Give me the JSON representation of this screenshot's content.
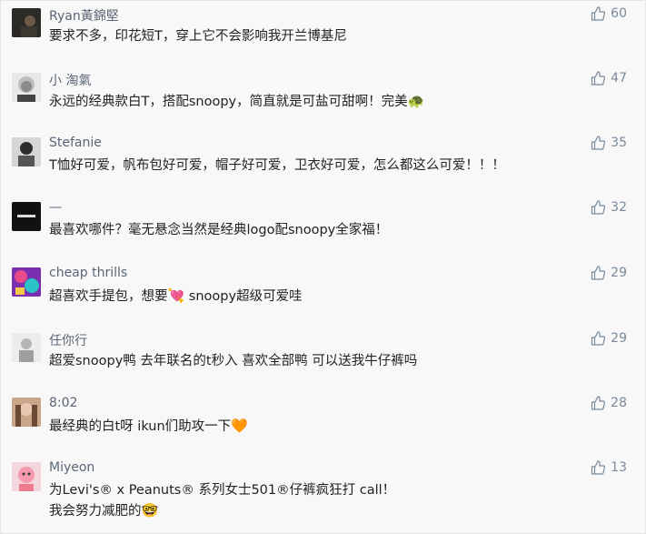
{
  "comments": [
    {
      "username": "Ryan黃錦堅",
      "text": "要求不多，印花短T，穿上它不会影响我开兰博基尼",
      "likes": "60",
      "avatar": "dark-photo"
    },
    {
      "username": "小 淘氣",
      "text": "永远的经典款白T，搭配snoopy，简直就是可盐可甜啊！完美",
      "emoji": "🐢",
      "likes": "47",
      "avatar": "einstein-photo"
    },
    {
      "username": "Stefanie",
      "text": "T恤好可爱，帆布包好可爱，帽子好可爱，卫衣好可爱，怎么都这么可爱！！！",
      "likes": "35",
      "avatar": "person-photo"
    },
    {
      "username": "—",
      "text": "最喜欢哪件？毫无悬念当然是经典logo配snoopy全家福！",
      "likes": "32",
      "avatar": "black-logo"
    },
    {
      "username": "cheap thrills",
      "text": "超喜欢手提包，想要",
      "emoji": "💘",
      "text2": " snoopy超级可爱哇",
      "likes": "29",
      "avatar": "colorful-art"
    },
    {
      "username": "任你行",
      "text": "超爱snoopy鸭 去年联名的t秒入 喜欢全部鸭 可以送我牛仔裤吗",
      "likes": "29",
      "avatar": "gray-photo"
    },
    {
      "username": "8:02",
      "text": "最经典的白t呀 ikun们助攻一下",
      "emoji": "🧡",
      "likes": "28",
      "avatar": "woman-photo"
    },
    {
      "username": "Miyeon",
      "text": "为Levi's® x Peanuts® 系列女士501®仔裤疯狂打 call！",
      "text_line2": "我会努力减肥的",
      "emoji": "🤓",
      "likes": "13",
      "avatar": "pink-cartoon"
    }
  ],
  "icons": {
    "like": "thumbs-up-icon"
  },
  "colors": {
    "username": "#5a6676",
    "text": "#222222",
    "like": "#7a8a9a"
  }
}
